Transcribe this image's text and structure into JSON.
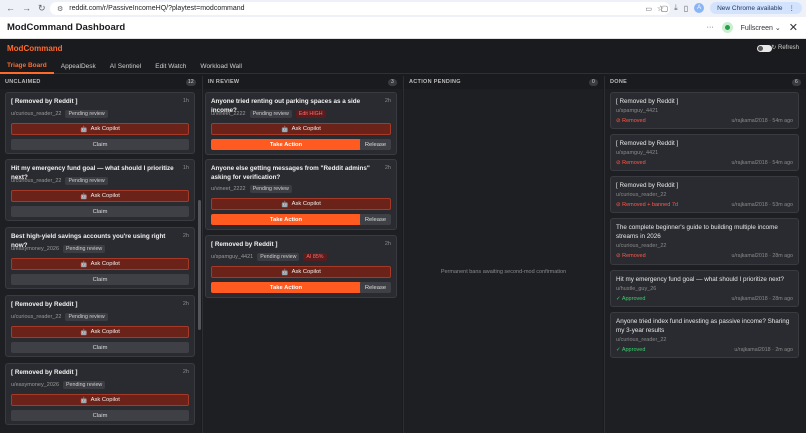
{
  "browser": {
    "url": "reddit.com/r/PassiveIncomeHQ/?playtest=modcommand",
    "update_label": "New Chrome available",
    "avatar_letter": "A"
  },
  "app_header": {
    "title": "ModCommand Dashboard",
    "more_label": "···",
    "fullscreen_label": "Fullscreen",
    "close_label": "✕"
  },
  "app_bar": {
    "brand": "ModCommand",
    "refresh_label": "↻ Refresh",
    "tabs": [
      {
        "label": "Triage Board",
        "active": true
      },
      {
        "label": "AppealDesk",
        "active": false
      },
      {
        "label": "AI Sentinel",
        "active": false
      },
      {
        "label": "Edit Watch",
        "active": false
      },
      {
        "label": "Workload Wall",
        "active": false
      }
    ]
  },
  "buttons": {
    "ask_copilot": "Ask Copilot",
    "claim": "Claim",
    "take_action": "Take Action",
    "release": "Release"
  },
  "columns": {
    "unclaimed": {
      "label": "UNCLAIMED",
      "count": "12",
      "cards": [
        {
          "title": "[ Removed by Reddit ]",
          "age": "1h",
          "user": "u/curious_reader_22",
          "status": "Pending review"
        },
        {
          "title": "Hit my emergency fund goal — what should I prioritize next?",
          "age": "1h",
          "user": "u/curious_reader_22",
          "status": "Pending review"
        },
        {
          "title": "Best high-yield savings accounts you're using right now?",
          "age": "2h",
          "user": "u/easymoney_2026",
          "status": "Pending review"
        },
        {
          "title": "[ Removed by Reddit ]",
          "age": "2h",
          "user": "u/curious_reader_22",
          "status": "Pending review"
        },
        {
          "title": "[ Removed by Reddit ]",
          "age": "2h",
          "user": "u/easymoney_2026",
          "status": "Pending review"
        }
      ]
    },
    "in_review": {
      "label": "IN REVIEW",
      "count": "3",
      "cards": [
        {
          "title": "Anyone tried renting out parking spaces as a side income?",
          "age": "2h",
          "user": "u/vineet_2222",
          "status": "Pending review",
          "risk": "Edit HIGH"
        },
        {
          "title": "Anyone else getting messages from \"Reddit admins\" asking for verification?",
          "age": "2h",
          "user": "u/vineet_2222",
          "status": "Pending review",
          "risk": ""
        },
        {
          "title": "[ Removed by Reddit ]",
          "age": "2h",
          "user": "u/spamguy_4421",
          "status": "Pending review",
          "risk": "AI 85%"
        }
      ]
    },
    "action_pending": {
      "label": "ACTION PENDING",
      "count": "0",
      "empty_note": "Permanent bans awaiting second-mod confirmation"
    },
    "done": {
      "label": "DONE",
      "count": "6",
      "cards": [
        {
          "title": "[ Removed by Reddit ]",
          "user": "u/spamguy_4421",
          "status": "⊘ Removed",
          "kind": "removed",
          "by": "u/rajkamal2018 · 54m ago"
        },
        {
          "title": "[ Removed by Reddit ]",
          "user": "u/spamguy_4421",
          "status": "⊘ Removed",
          "kind": "removed",
          "by": "u/rajkamal2018 · 54m ago"
        },
        {
          "title": "[ Removed by Reddit ]",
          "user": "u/curious_reader_22",
          "status": "⊘ Removed + banned 7d",
          "kind": "removed",
          "by": "u/rajkamal2018 · 53m ago"
        },
        {
          "title": "The complete beginner's guide to building multiple income streams in 2026",
          "user": "u/curious_reader_22",
          "status": "⊘ Removed",
          "kind": "removed",
          "by": "u/rajkamal2018 · 28m ago"
        },
        {
          "title": "Hit my emergency fund goal — what should I prioritize next?",
          "user": "u/hustle_guy_26",
          "status": "✓ Approved",
          "kind": "approved",
          "by": "u/rajkamal2018 · 28m ago"
        },
        {
          "title": "Anyone tried index fund investing as passive income? Sharing my 3-year results",
          "user": "u/curious_reader_22",
          "status": "✓ Approved",
          "kind": "approved",
          "by": "u/rajkamal2018 · 2m ago"
        }
      ]
    }
  }
}
